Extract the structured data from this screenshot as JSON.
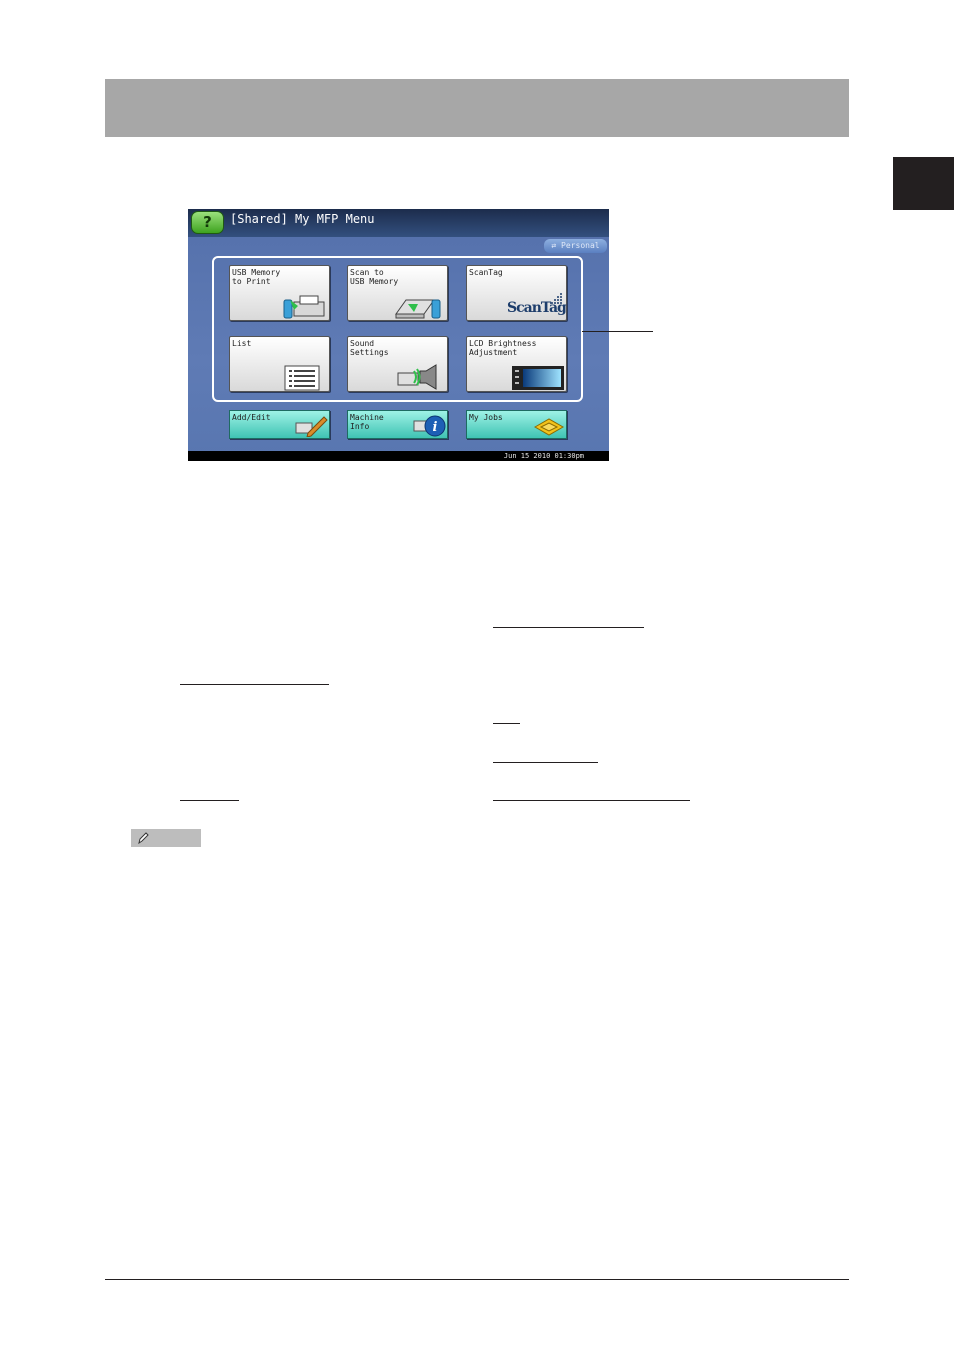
{
  "lcd": {
    "help_label": "?",
    "title": "[Shared] My MFP Menu",
    "personal_label": "Personal",
    "datetime": "Jun 15 2010 01:30pm",
    "functions": [
      {
        "label": "USB Memory\nto Print",
        "icon": "usb-print-icon"
      },
      {
        "label": "Scan to\nUSB Memory",
        "icon": "scanner-icon"
      },
      {
        "label": "ScanTag",
        "icon": "scantag-logo",
        "logo_text": "ScanTag"
      },
      {
        "label": "List",
        "icon": "list-icon"
      },
      {
        "label": "Sound\nSettings",
        "icon": "speaker-icon"
      },
      {
        "label": "LCD Brightness\nAdjustment",
        "icon": "lcd-brightness-icon"
      }
    ],
    "bottom": [
      {
        "label": "Add/Edit",
        "icon": "pencil-icon"
      },
      {
        "label": "Machine\nInfo",
        "icon": "info-icon"
      },
      {
        "label": "My Jobs",
        "icon": "jobs-icon"
      }
    ]
  },
  "colors": {
    "header_band": "#a7a7a7",
    "side_tab": "#231f20",
    "lcd_background": "#5f7bb5",
    "function_button": "#e8e8e8",
    "bottom_button": "#6fd8cb",
    "help_button": "#5cc03a"
  }
}
